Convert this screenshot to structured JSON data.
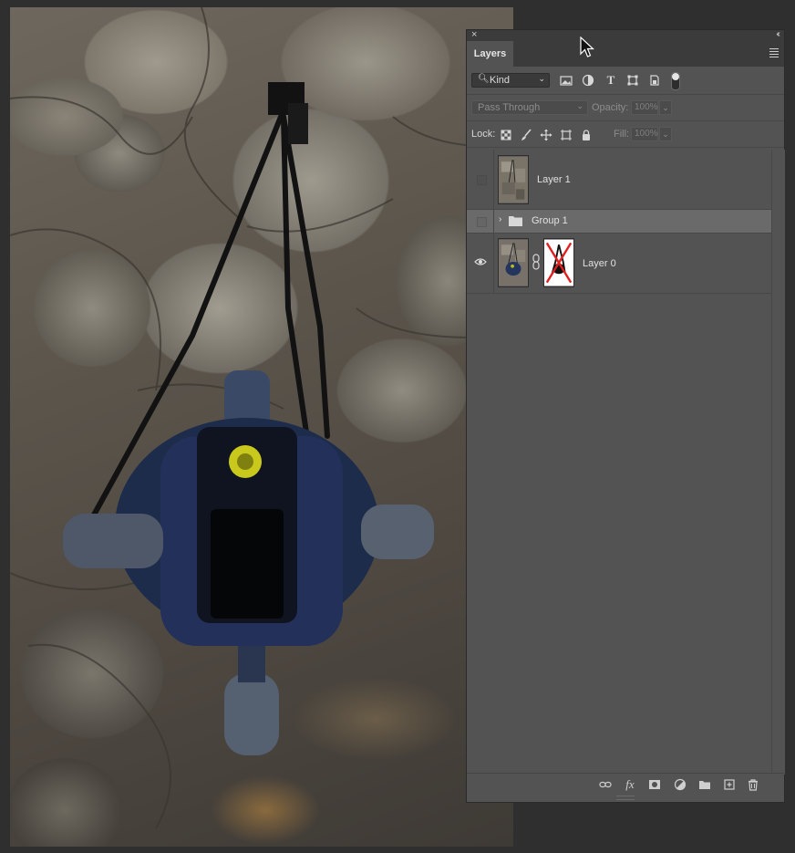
{
  "panel": {
    "tab_label": "Layers",
    "close_glyph": "×",
    "collapse_glyph": "‹‹",
    "filter": {
      "kind_label": "Kind",
      "icons": [
        "pixel-filter-icon",
        "adjustment-filter-icon",
        "type-filter-icon",
        "shape-filter-icon",
        "smart-object-filter-icon"
      ]
    },
    "blend": {
      "mode": "Pass Through",
      "opacity_label": "Opacity:",
      "opacity_value": "100%"
    },
    "lock": {
      "label": "Lock:",
      "fill_label": "Fill:",
      "fill_value": "100%"
    },
    "layers": [
      {
        "name": "Layer 1",
        "visible": false,
        "type": "pixel"
      },
      {
        "name": "Group 1",
        "visible": false,
        "type": "group",
        "selected": true
      },
      {
        "name": "Layer 0",
        "visible": true,
        "type": "pixel-with-mask"
      }
    ],
    "bottom_icons": [
      "link-layers-icon",
      "fx-icon",
      "add-mask-icon",
      "adjustment-layer-icon",
      "new-group-icon",
      "new-layer-icon",
      "delete-layer-icon"
    ],
    "fx_text": "fx"
  },
  "colors": {
    "panel_bg": "#535353",
    "panel_header": "#3b3b3b",
    "selected_row": "#6a6a6a",
    "mask_cross": "#e02020"
  }
}
